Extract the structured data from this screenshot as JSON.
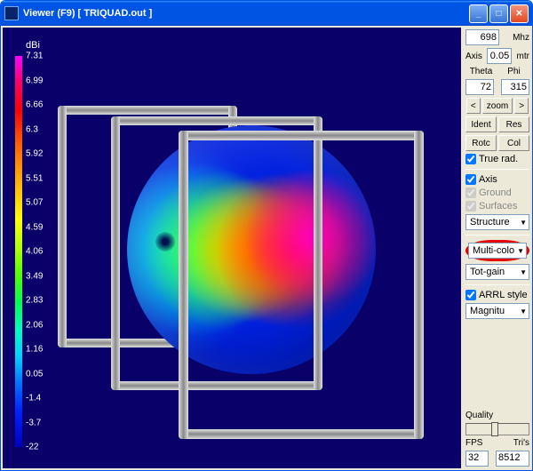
{
  "window": {
    "title": "Viewer (F9)      [  TRIQUAD.out  ]"
  },
  "viewport": {
    "unit_label": "dBi",
    "scale_ticks": [
      "7.31",
      "6.99",
      "6.66",
      "6.3",
      "5.92",
      "5.51",
      "5.07",
      "4.59",
      "4.06",
      "3.49",
      "2.83",
      "2.06",
      "1.16",
      "0.05",
      "-1.4",
      "-3.7",
      "-22"
    ]
  },
  "sidebar": {
    "freq_value": "698",
    "freq_unit": "Mhz",
    "axis_label": "Axis",
    "axis_value": "0.05",
    "axis_unit": "mtr",
    "theta_label": "Theta",
    "phi_label": "Phi",
    "theta_value": "72",
    "phi_value": "315",
    "zoom_prev": "<",
    "zoom_label": "zoom",
    "zoom_next": ">",
    "ident_btn": "Ident",
    "res_btn": "Res",
    "rotc_btn": "Rotc",
    "col_btn": "Col",
    "true_rad": "True rad.",
    "axis_chk": "Axis",
    "ground_chk": "Ground",
    "surfaces_chk": "Surfaces",
    "structure_sel": "Structure",
    "color_sel": "Multi-colo",
    "gain_sel": "Tot-gain",
    "arrl_chk": "ARRL style",
    "magnitude_sel": "Magnitu",
    "quality_label": "Quality",
    "fps_label": "FPS",
    "tris_label": "Tri's",
    "fps_value": "32",
    "tris_value": "8512"
  },
  "chart_data": {
    "type": "other",
    "description": "3D radiation pattern (gain sphere) for TRIQUAD antenna with tri-quad wireframe structure",
    "colorbar_unit": "dBi",
    "colorbar_values": [
      7.31,
      6.99,
      6.66,
      6.3,
      5.92,
      5.51,
      5.07,
      4.59,
      4.06,
      3.49,
      2.83,
      2.06,
      1.16,
      0.05,
      -1.4,
      -3.7,
      -22
    ],
    "frequency_mhz": 698,
    "theta_deg": 72,
    "phi_deg": 315,
    "axis_length_m": 0.05,
    "color_mode": "Multi-color",
    "quantity": "Tot-gain",
    "scale_style": "ARRL",
    "display": "Magnitude"
  }
}
